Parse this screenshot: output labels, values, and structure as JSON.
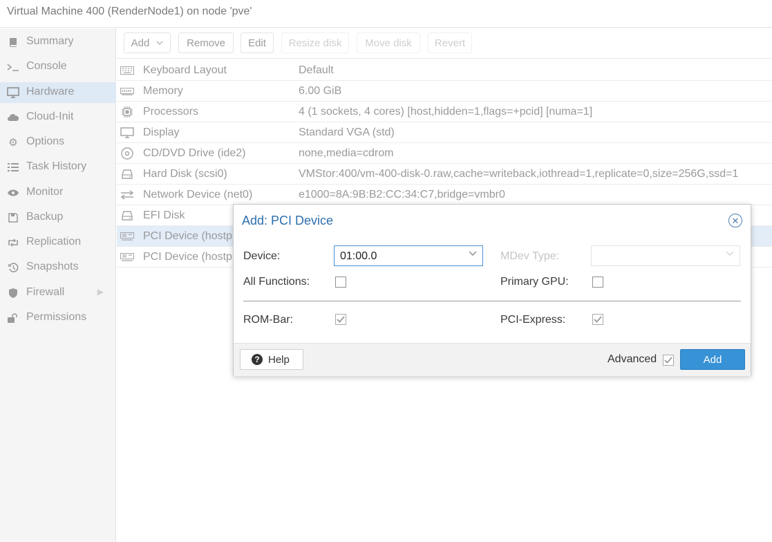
{
  "header": {
    "title": "Virtual Machine 400 (RenderNode1) on node 'pve'"
  },
  "sidebar": {
    "items": [
      {
        "label": "Summary",
        "icon": "book-icon"
      },
      {
        "label": "Console",
        "icon": "terminal-icon"
      },
      {
        "label": "Hardware",
        "icon": "monitor-icon",
        "active": true
      },
      {
        "label": "Cloud-Init",
        "icon": "cloud-icon"
      },
      {
        "label": "Options",
        "icon": "gear-icon"
      },
      {
        "label": "Task History",
        "icon": "list-icon"
      },
      {
        "label": "Monitor",
        "icon": "eye-icon"
      },
      {
        "label": "Backup",
        "icon": "floppy-icon"
      },
      {
        "label": "Replication",
        "icon": "retweet-icon"
      },
      {
        "label": "Snapshots",
        "icon": "history-icon"
      },
      {
        "label": "Firewall",
        "icon": "shield-icon"
      },
      {
        "label": "Permissions",
        "icon": "unlock-icon"
      }
    ]
  },
  "toolbar": {
    "add_label": "Add",
    "remove_label": "Remove",
    "edit_label": "Edit",
    "resize_label": "Resize disk",
    "move_label": "Move disk",
    "revert_label": "Revert"
  },
  "hardware": {
    "rows": [
      {
        "name": "Keyboard Layout",
        "value": "Default",
        "icon": "keyboard-icon"
      },
      {
        "name": "Memory",
        "value": "6.00 GiB",
        "icon": "memory-icon"
      },
      {
        "name": "Processors",
        "value": "4 (1 sockets, 4 cores) [host,hidden=1,flags=+pcid] [numa=1]",
        "icon": "cpu-icon"
      },
      {
        "name": "Display",
        "value": "Standard VGA (std)",
        "icon": "desktop-icon"
      },
      {
        "name": "CD/DVD Drive (ide2)",
        "value": "none,media=cdrom",
        "icon": "cdrom-icon"
      },
      {
        "name": "Hard Disk (scsi0)",
        "value": "VMStor:400/vm-400-disk-0.raw,cache=writeback,iothread=1,replicate=0,size=256G,ssd=1",
        "icon": "hdd-icon"
      },
      {
        "name": "Network Device (net0)",
        "value": "e1000=8A:9B:B2:CC:34:C7,bridge=vmbr0",
        "icon": "exchange-icon"
      },
      {
        "name": "EFI Disk",
        "value": "",
        "icon": "hdd-icon"
      },
      {
        "name": "PCI Device (hostp",
        "value": "",
        "icon": "pci-card-icon",
        "selected": true
      },
      {
        "name": "PCI Device (hostp",
        "value": "",
        "icon": "pci-card-icon"
      }
    ]
  },
  "dialog": {
    "title": "Add: PCI Device",
    "device_label": "Device:",
    "device_value": "01:00.0",
    "mdev_label": "MDev Type:",
    "mdev_value": "",
    "all_functions_label": "All Functions:",
    "primary_gpu_label": "Primary GPU:",
    "rombar_label": "ROM-Bar:",
    "pciexpress_label": "PCI-Express:",
    "help_label": "Help",
    "advanced_label": "Advanced",
    "add_label": "Add"
  }
}
